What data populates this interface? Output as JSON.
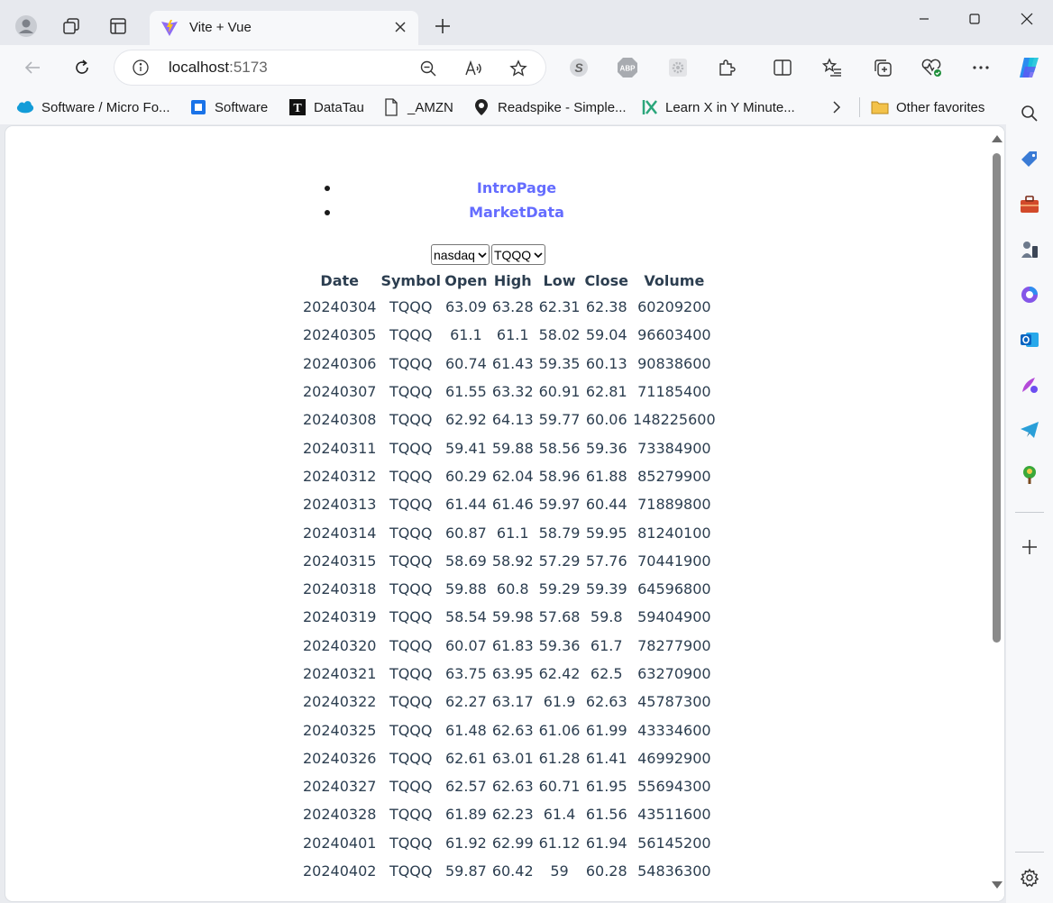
{
  "browser": {
    "tab": {
      "title": "Vite + Vue"
    },
    "address": {
      "host": "localhost",
      "port": ":5173"
    },
    "favorites": [
      {
        "label": "Software / Micro Fo...",
        "icon": "salesforce-cloud-icon"
      },
      {
        "label": "Software",
        "icon": "blue-square-icon"
      },
      {
        "label": "DataTau",
        "icon": "datatau-t-icon"
      },
      {
        "label": "_AMZN",
        "icon": "page-icon"
      },
      {
        "label": "Readspike - Simple...",
        "icon": "readspike-shield-icon"
      },
      {
        "label": "Learn X in Y Minute...",
        "icon": "learnx-icon"
      },
      {
        "label": "Other favorites",
        "icon": "folder-icon"
      }
    ]
  },
  "nav": {
    "links": [
      "IntroPage",
      "MarketData"
    ]
  },
  "filters": {
    "exchange": "nasdaq",
    "symbol": "TQQQ"
  },
  "table": {
    "headers": [
      "Date",
      "Symbol",
      "Open",
      "High",
      "Low",
      "Close",
      "Volume"
    ],
    "rows": [
      [
        "20240304",
        "TQQQ",
        "63.09",
        "63.28",
        "62.31",
        "62.38",
        "60209200"
      ],
      [
        "20240305",
        "TQQQ",
        "61.1",
        "61.1",
        "58.02",
        "59.04",
        "96603400"
      ],
      [
        "20240306",
        "TQQQ",
        "60.74",
        "61.43",
        "59.35",
        "60.13",
        "90838600"
      ],
      [
        "20240307",
        "TQQQ",
        "61.55",
        "63.32",
        "60.91",
        "62.81",
        "71185400"
      ],
      [
        "20240308",
        "TQQQ",
        "62.92",
        "64.13",
        "59.77",
        "60.06",
        "148225600"
      ],
      [
        "20240311",
        "TQQQ",
        "59.41",
        "59.88",
        "58.56",
        "59.36",
        "73384900"
      ],
      [
        "20240312",
        "TQQQ",
        "60.29",
        "62.04",
        "58.96",
        "61.88",
        "85279900"
      ],
      [
        "20240313",
        "TQQQ",
        "61.44",
        "61.46",
        "59.97",
        "60.44",
        "71889800"
      ],
      [
        "20240314",
        "TQQQ",
        "60.87",
        "61.1",
        "58.79",
        "59.95",
        "81240100"
      ],
      [
        "20240315",
        "TQQQ",
        "58.69",
        "58.92",
        "57.29",
        "57.76",
        "70441900"
      ],
      [
        "20240318",
        "TQQQ",
        "59.88",
        "60.8",
        "59.29",
        "59.39",
        "64596800"
      ],
      [
        "20240319",
        "TQQQ",
        "58.54",
        "59.98",
        "57.68",
        "59.8",
        "59404900"
      ],
      [
        "20240320",
        "TQQQ",
        "60.07",
        "61.83",
        "59.36",
        "61.7",
        "78277900"
      ],
      [
        "20240321",
        "TQQQ",
        "63.75",
        "63.95",
        "62.42",
        "62.5",
        "63270900"
      ],
      [
        "20240322",
        "TQQQ",
        "62.27",
        "63.17",
        "61.9",
        "62.63",
        "45787300"
      ],
      [
        "20240325",
        "TQQQ",
        "61.48",
        "62.63",
        "61.06",
        "61.99",
        "43334600"
      ],
      [
        "20240326",
        "TQQQ",
        "62.61",
        "63.01",
        "61.28",
        "61.41",
        "46992900"
      ],
      [
        "20240327",
        "TQQQ",
        "62.57",
        "62.63",
        "60.71",
        "61.95",
        "55694300"
      ],
      [
        "20240328",
        "TQQQ",
        "61.89",
        "62.23",
        "61.4",
        "61.56",
        "43511600"
      ],
      [
        "20240401",
        "TQQQ",
        "61.92",
        "62.99",
        "61.12",
        "61.94",
        "56145200"
      ],
      [
        "20240402",
        "TQQQ",
        "59.87",
        "60.42",
        "59",
        "60.28",
        "54836300"
      ]
    ]
  },
  "colors": {
    "link": "#646cff",
    "text": "#2c3e50",
    "chrome": "#e7e9ee"
  }
}
